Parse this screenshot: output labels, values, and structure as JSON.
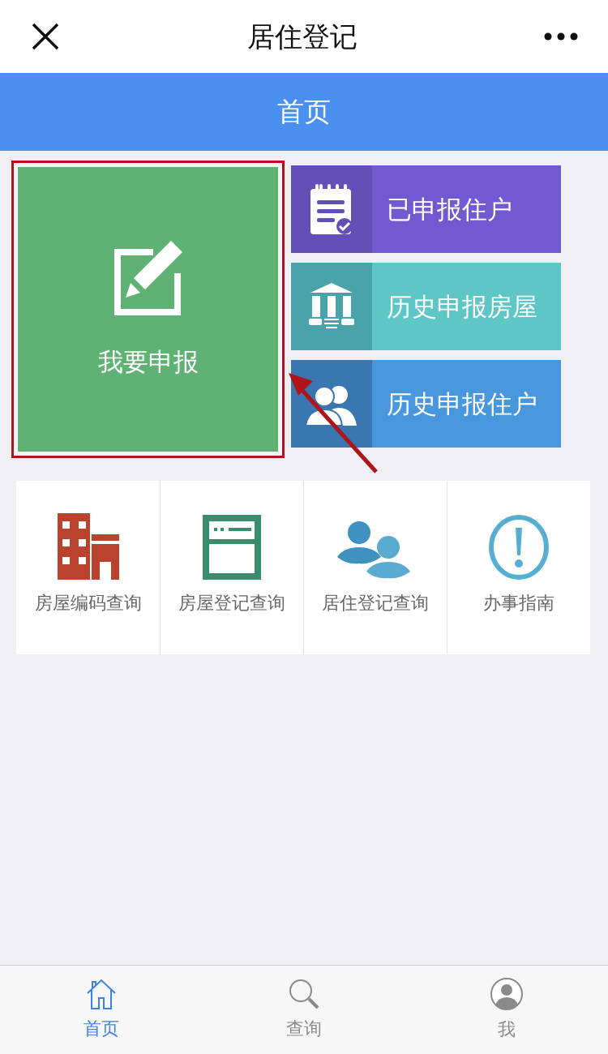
{
  "header": {
    "title": "居住登记"
  },
  "banner": {
    "title": "首页"
  },
  "main_tile": {
    "label": "我要申报"
  },
  "side_tiles": [
    {
      "label": "已申报住户",
      "color": "#7059d1"
    },
    {
      "label": "历史申报房屋",
      "color": "#5fc6c6"
    },
    {
      "label": "历史申报住户",
      "color": "#4897dc"
    }
  ],
  "quick_links": [
    {
      "label": "房屋编码查询"
    },
    {
      "label": "房屋登记查询"
    },
    {
      "label": "居住登记查询"
    },
    {
      "label": "办事指南"
    }
  ],
  "tabs": [
    {
      "label": "首页",
      "selected": true
    },
    {
      "label": "查询",
      "selected": false
    },
    {
      "label": "我",
      "selected": false
    }
  ]
}
